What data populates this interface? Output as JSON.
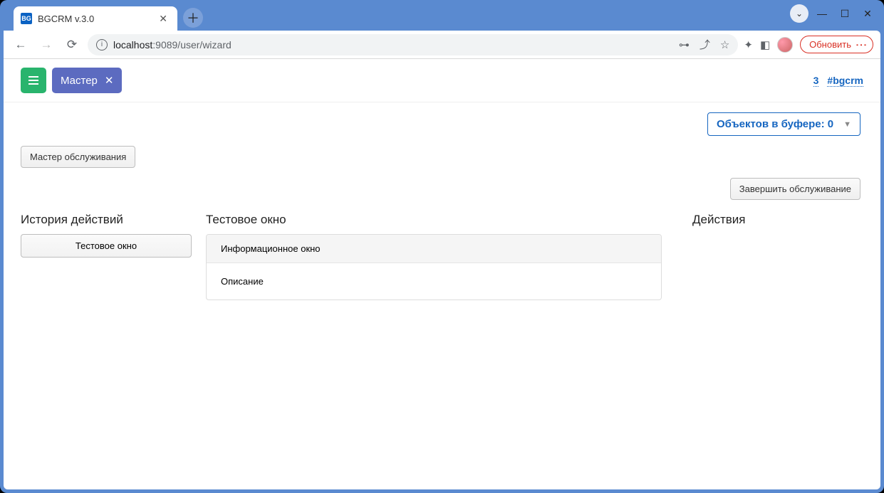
{
  "browser": {
    "tab_title": "BGCRM v.3.0",
    "favicon_text": "BG",
    "url_host": "localhost",
    "url_port_path": ":9089/user/wizard",
    "update_label": "Обновить"
  },
  "header": {
    "tab_label": "Мастер",
    "link_count": "3",
    "link_tag": "#bgcrm"
  },
  "buffer": {
    "label_prefix": "Объектов в буфере: ",
    "count": "0"
  },
  "wizard": {
    "service_wizard_btn": "Мастер обслуживания",
    "finish_btn": "Завершить обслуживание"
  },
  "columns": {
    "history_title": "История действий",
    "history_item": "Тестовое окно",
    "main_title": "Тестовое окно",
    "card_header": "Информационное окно",
    "card_body": "Описание",
    "actions_title": "Действия"
  }
}
